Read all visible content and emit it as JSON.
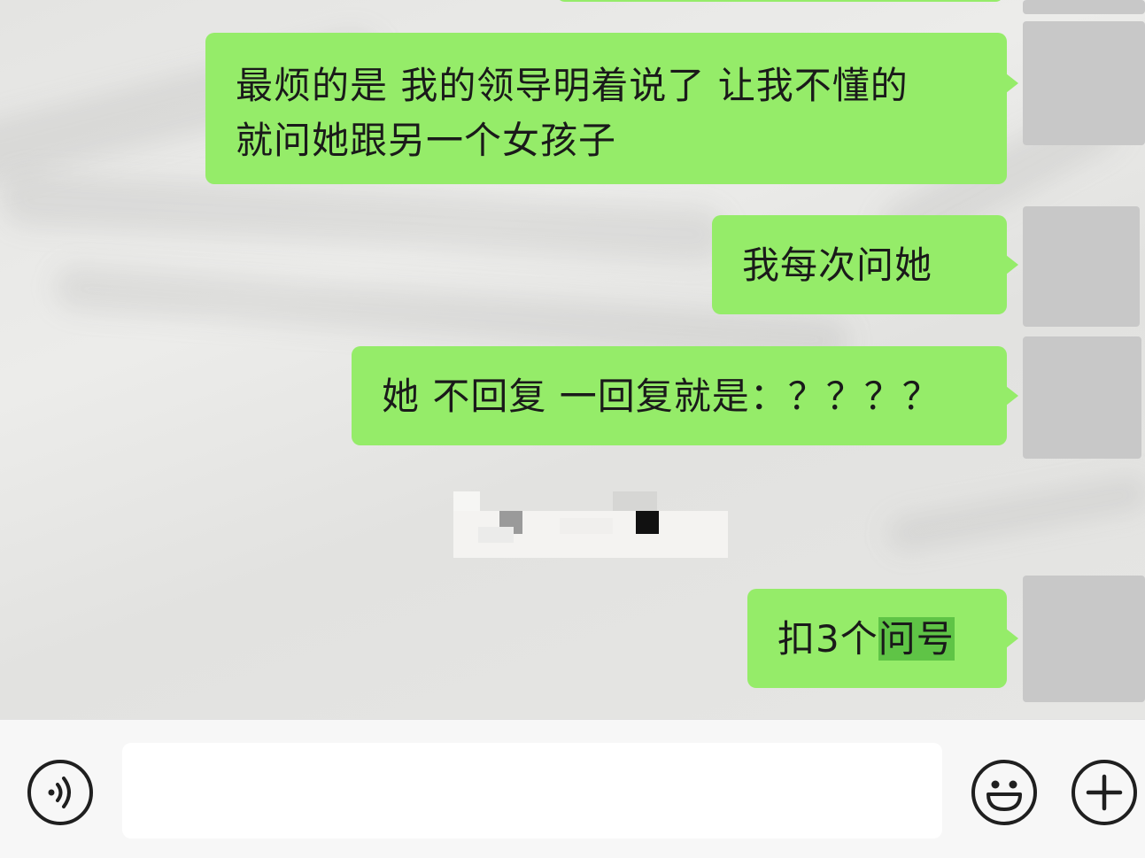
{
  "chat": {
    "messages": [
      {
        "text_line1": "最烦的是 我的领导明着说了 让我不懂的",
        "text_line2": "就问她跟另一个女孩子"
      },
      {
        "text": "我每次问她"
      },
      {
        "text": "她 不回复 一回复就是：？？？？"
      },
      {
        "text_before": "扣3个",
        "text_highlight": "问号"
      }
    ]
  },
  "input_bar": {
    "voice_icon": "voice-icon",
    "emoji_icon": "emoji-icon",
    "plus_icon": "plus-icon",
    "message_value": ""
  },
  "colors": {
    "bubble_green": "#95ec69",
    "highlight_green": "#5fc446",
    "avatar_gray": "#c8c8c8"
  }
}
